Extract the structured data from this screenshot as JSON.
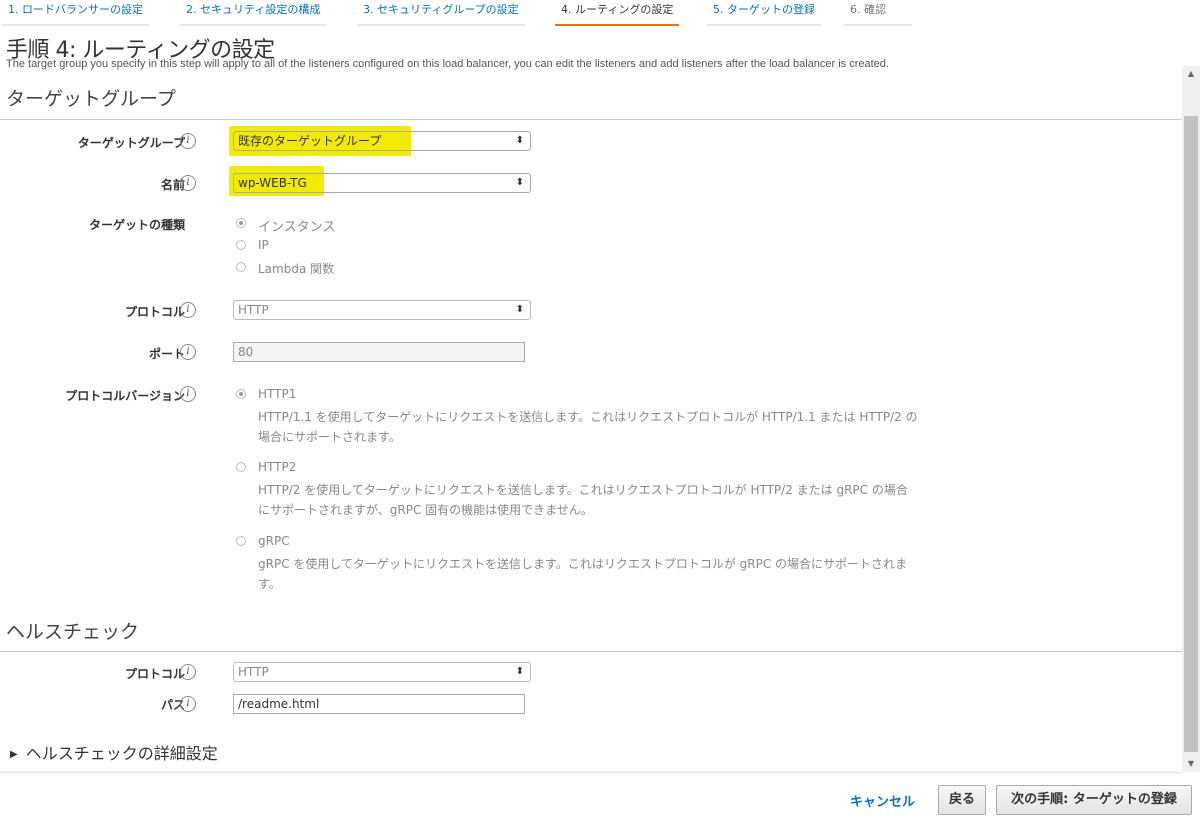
{
  "steps": [
    {
      "label": "1. ロードバランサーの設定"
    },
    {
      "label": "2. セキュリティ設定の構成"
    },
    {
      "label": "3. セキュリティグループの設定"
    },
    {
      "label": "4. ルーティングの設定"
    },
    {
      "label": "5. ターゲットの登録"
    },
    {
      "label": "6. 確認"
    }
  ],
  "page": {
    "title": "手順 4: ルーティングの設定",
    "intro": "The target group you specify in this step will apply to all of the listeners configured on this load balancer, you can edit the listeners and add listeners after the load balancer is created."
  },
  "target_group": {
    "section_title": "ターゲットグループ",
    "tg_label": "ターゲットグループ",
    "tg_value": "既存のターゲットグループ",
    "name_label": "名前",
    "name_value": "wp-WEB-TG",
    "type_label": "ターゲットの種類",
    "type_options": [
      "インスタンス",
      "IP",
      "Lambda 関数"
    ],
    "protocol_label": "プロトコル",
    "protocol_value": "HTTP",
    "port_label": "ポート",
    "port_value": "80",
    "version_label": "プロトコルバージョン",
    "versions": [
      {
        "name": "HTTP1",
        "desc": "HTTP/1.1 を使用してターゲットにリクエストを送信します。これはリクエストプロトコルが HTTP/1.1 または HTTP/2 の場合にサポートされます。"
      },
      {
        "name": "HTTP2",
        "desc": "HTTP/2 を使用してターゲットにリクエストを送信します。これはリクエストプロトコルが HTTP/2 または gRPC の場合にサポートされますが、gRPC 固有の機能は使用できません。"
      },
      {
        "name": "gRPC",
        "desc": "gRPC を使用してターゲットにリクエストを送信します。これはリクエストプロトコルが gRPC の場合にサポートされます。"
      }
    ]
  },
  "health": {
    "section_title": "ヘルスチェック",
    "protocol_label": "プロトコル",
    "protocol_value": "HTTP",
    "path_label": "パス",
    "path_value": "/readme.html",
    "advanced_label": "ヘルスチェックの詳細設定"
  },
  "footer": {
    "cancel": "キャンセル",
    "back": "戻る",
    "next": "次の手順: ターゲットの登録"
  },
  "icons": {
    "info": "i",
    "select_arrow": "⬍",
    "expand": "▶",
    "scroll_up": "▲",
    "scroll_down": "▼"
  },
  "colors": {
    "link": "#0073bb",
    "active_step": "#ec7211",
    "highlight": "#f2ea00"
  }
}
